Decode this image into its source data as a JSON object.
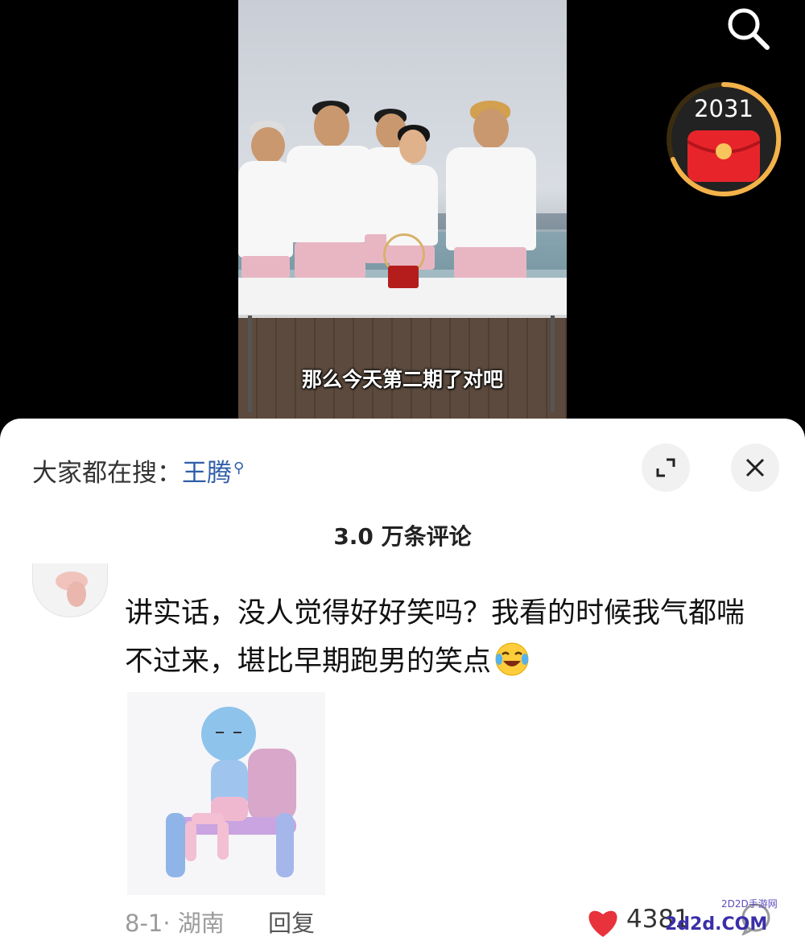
{
  "video": {
    "subtitle": "那么今天第二期了对吧"
  },
  "top_right": {
    "search_icon": "search-icon",
    "redpacket_count": "2031",
    "redpacket_icon": "red-envelope-icon"
  },
  "sheet": {
    "trending_prefix": "大家都在搜：",
    "trending_term": "王腾",
    "comment_count": "3.0 万条评论",
    "expand_icon": "expand-icon",
    "close_icon": "close-icon"
  },
  "comment": {
    "text": "讲实话，没人觉得好好笑吗？我看的时候我气都喘不过来，堪比早期跑男的笑点",
    "emoji": "laughing-crying-emoji",
    "date_location": "8-1· 湖南",
    "reply_label": "回复",
    "like_count": "4381",
    "like_color": "#e8323c"
  },
  "watermark": {
    "small": "2D2D手游网",
    "big": "2d2d.COM"
  }
}
